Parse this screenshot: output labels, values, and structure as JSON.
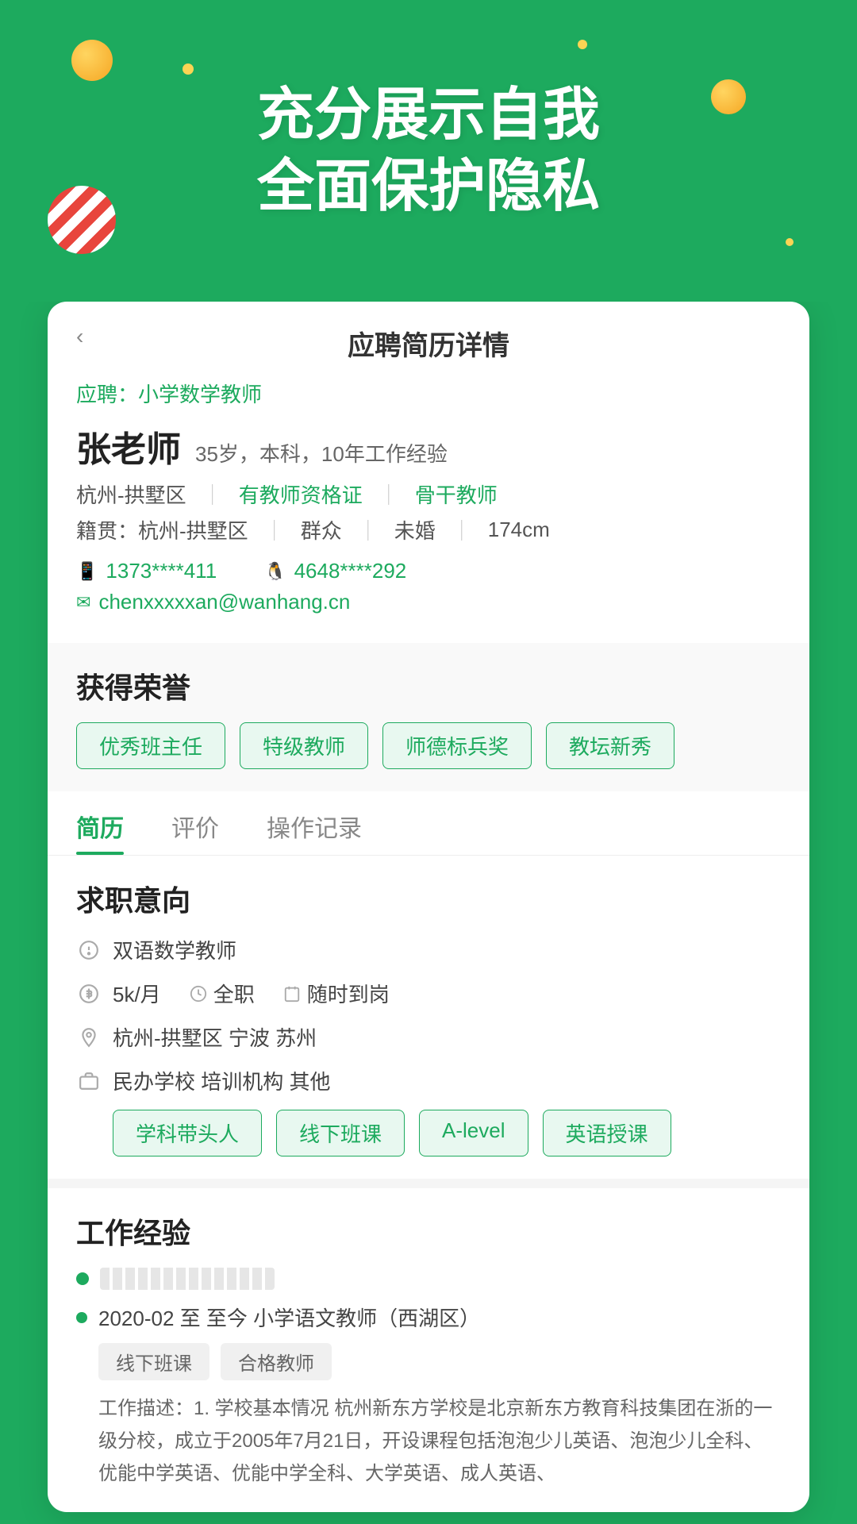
{
  "hero": {
    "title_line1": "充分展示自我",
    "title_line2": "全面保护隐私"
  },
  "card": {
    "back_label": "‹",
    "title": "应聘简历详情",
    "job_link": "应聘：小学数学教师",
    "profile": {
      "name": "张老师",
      "meta": "35岁，本科，10年工作经验",
      "info_row1_loc": "杭州-拱墅区",
      "info_row1_cert": "有教师资格证",
      "info_row1_tag": "骨干教师",
      "info_row2_origin": "籍贯：杭州-拱墅区",
      "info_row2_party": "群众",
      "info_row2_marriage": "未婚",
      "info_row2_height": "174cm",
      "phone": "1373****411",
      "qq": "4648****292",
      "email": "chenxxxxxan@wanhang.cn"
    },
    "honors": {
      "section_title": "获得荣誉",
      "tags": [
        "优秀班主任",
        "特级教师",
        "师德标兵奖",
        "教坛新秀"
      ]
    },
    "tabs": [
      {
        "label": "简历",
        "active": true
      },
      {
        "label": "评价",
        "active": false
      },
      {
        "label": "操作记录",
        "active": false
      }
    ],
    "intent": {
      "section_title": "求职意向",
      "position": "双语数学教师",
      "salary": "5k/月",
      "job_type": "全职",
      "availability": "随时到岗",
      "locations": "杭州-拱墅区  宁波  苏州",
      "org_types": "民办学校   培训机构   其他",
      "tags": [
        "学科带头人",
        "线下班课",
        "A-level",
        "英语授课"
      ]
    },
    "work": {
      "section_title": "工作经验",
      "company_name_hidden": true,
      "period": "2020-02 至 至今 小学语文教师（西湖区）",
      "work_tags": [
        "线下班课",
        "合格教师"
      ],
      "description": "工作描述：1. 学校基本情况 杭州新东方学校是北京新东方教育科技集团在浙的一级分校，成立于2005年7月21日，开设课程包括泡泡少儿英语、泡泡少儿全科、优能中学英语、优能中学全科、大学英语、成人英语、"
    }
  }
}
